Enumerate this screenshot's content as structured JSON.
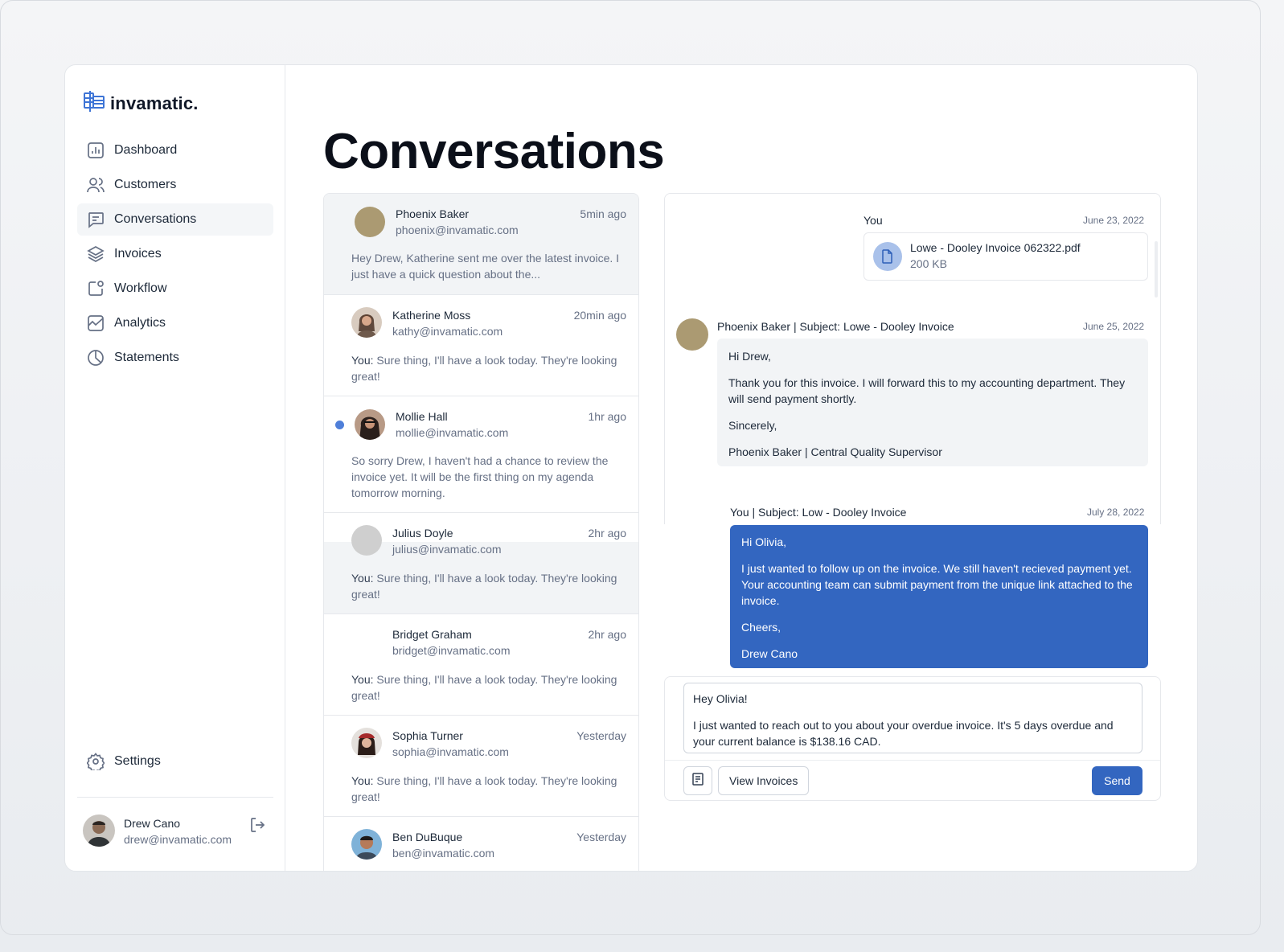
{
  "brand": {
    "name": "invamatic."
  },
  "page": {
    "title": "Conversations"
  },
  "sidebar": {
    "items": [
      {
        "label": "Dashboard",
        "icon": "bar-chart-icon"
      },
      {
        "label": "Customers",
        "icon": "users-icon"
      },
      {
        "label": "Conversations",
        "icon": "message-icon",
        "active": true
      },
      {
        "label": "Invoices",
        "icon": "layers-icon"
      },
      {
        "label": "Workflow",
        "icon": "workflow-icon"
      },
      {
        "label": "Analytics",
        "icon": "line-chart-icon"
      },
      {
        "label": "Statements",
        "icon": "pie-chart-icon"
      }
    ],
    "settings_label": "Settings",
    "user": {
      "name": "Drew Cano",
      "email": "drew@invamatic.com"
    }
  },
  "conversations": [
    {
      "name": "Phoenix Baker",
      "email": "phoenix@invamatic.com",
      "time": "5min ago",
      "preview_prefix": "",
      "preview": "Hey Drew, Katherine sent me over the latest invoice. I just have a quick question about the...",
      "selected": true
    },
    {
      "name": "Katherine Moss",
      "email": "kathy@invamatic.com",
      "time": "20min ago",
      "preview_prefix": "You:",
      "preview": "Sure thing, I'll have a look today. They're looking great!"
    },
    {
      "name": "Mollie Hall",
      "email": "mollie@invamatic.com",
      "time": "1hr ago",
      "preview_prefix": "",
      "preview": "So sorry Drew, I haven't had a chance to review the invoice yet. It will be the first thing on my agenda tomorrow morning.",
      "unread": true
    },
    {
      "name": "Julius Doyle",
      "email": "julius@invamatic.com",
      "time": "2hr ago",
      "preview_prefix": "You:",
      "preview": "Sure thing, I'll have a look today. They're looking great!"
    },
    {
      "name": "Bridget Graham",
      "email": "bridget@invamatic.com",
      "time": "2hr ago",
      "preview_prefix": "You:",
      "preview": "Sure thing, I'll have a look today. They're looking great!"
    },
    {
      "name": "Sophia Turner",
      "email": "sophia@invamatic.com",
      "time": "Yesterday",
      "preview_prefix": "You:",
      "preview": "Sure thing, I'll have a look today. They're looking great!"
    },
    {
      "name": "Ben DuBuque",
      "email": "ben@invamatic.com",
      "time": "Yesterday",
      "preview_prefix": "",
      "preview": ""
    }
  ],
  "chat": {
    "msg1": {
      "sender": "You",
      "date": "June 23, 2022",
      "file_name": "Lowe - Dooley Invoice 062322.pdf",
      "file_size": "200 KB"
    },
    "msg2": {
      "sender": "Phoenix Baker | Subject: Lowe - Dooley Invoice",
      "date": "June 25, 2022",
      "lines": [
        "Hi Drew,",
        "Thank you for this invoice. I will forward this to my accounting department. They will send payment shortly.",
        "Sincerely,",
        "Phoenix Baker | Central Quality Supervisor"
      ]
    },
    "msg3": {
      "sender": "You | Subject: Low - Dooley Invoice",
      "date": "July 28, 2022",
      "lines": [
        "Hi Olivia,",
        "I just wanted to follow up on the invoice. We still haven't recieved payment yet. Your accounting team can submit payment from the unique link attached to the invoice.",
        "Cheers,",
        "Drew Cano"
      ]
    }
  },
  "composer": {
    "lines": [
      "Hey Olivia!",
      "I just wanted to reach out to you about your overdue invoice. It's 5 days overdue and your current balance is $138.16 CAD."
    ],
    "view_invoices_label": "View Invoices",
    "send_label": "Send"
  },
  "colors": {
    "accent": "#3366c0",
    "unread": "#4f7fd9",
    "avatar_placeholder": "#ab9a72"
  }
}
